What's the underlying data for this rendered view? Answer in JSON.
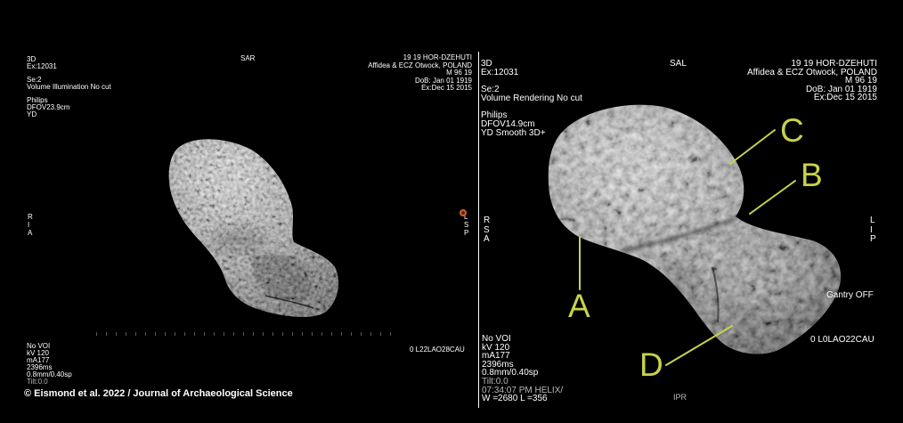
{
  "colors": {
    "background": "#000000",
    "text": "#ffffff",
    "annotation": "#c8d24b",
    "divider": "#ffffff",
    "marker": "#d0602e"
  },
  "copyright": "© Eismond et al. 2022 / Journal of Archaeological Science",
  "left_view": {
    "series_info": [
      [
        "3D",
        "Ex:12031"
      ],
      [
        "Se:2",
        "Volume Illumination No cut"
      ],
      [
        "Philips",
        "DFOV23.9cm",
        "YD"
      ]
    ],
    "orientation_top": "SAR",
    "patient_info": [
      "19 19 HOR-DZEHUTI",
      "Affidea & ECZ Otwock, POLAND",
      "M 96 19",
      "DoB: Jan 01 1919",
      "Ex:Dec 15 2015"
    ],
    "orientation_left": [
      "R",
      "I",
      "A"
    ],
    "orientation_right": [
      "L",
      "S",
      "P"
    ],
    "acquisition": [
      "No VOI",
      "kV 120",
      "mA177",
      "2396ms",
      "0.8mm/0.40sp",
      "Tilt:0.0"
    ],
    "view_angle": "0 L22LAO28CAU"
  },
  "right_view": {
    "series_info": [
      [
        "3D",
        "Ex:12031"
      ],
      [
        "Se:2",
        "Volume Rendering No cut"
      ],
      [
        "Philips",
        "DFOV14.9cm",
        "YD Smooth 3D+"
      ]
    ],
    "orientation_top": "SAL",
    "patient_info": [
      "19 19 HOR-DZEHUTI",
      "Affidea & ECZ Otwock, POLAND",
      "M 96 19",
      "DoB: Jan 01 1919",
      "Ex:Dec 15 2015"
    ],
    "orientation_left": [
      "R",
      "S",
      "A"
    ],
    "orientation_right": [
      "L",
      "I",
      "P"
    ],
    "acquisition": [
      "No VOI",
      "kV 120",
      "mA177",
      "2396ms",
      "0.8mm/0.40sp",
      "Tilt:0.0",
      "07:34:07 PM HELIX/",
      "W =2680 L =356"
    ],
    "gantry": "Gantry OFF",
    "view_angle": "0 L0LAO22CAU",
    "reconstruction": "IPR",
    "annotations": [
      {
        "label": "A"
      },
      {
        "label": "B"
      },
      {
        "label": "C"
      },
      {
        "label": "D"
      }
    ]
  }
}
